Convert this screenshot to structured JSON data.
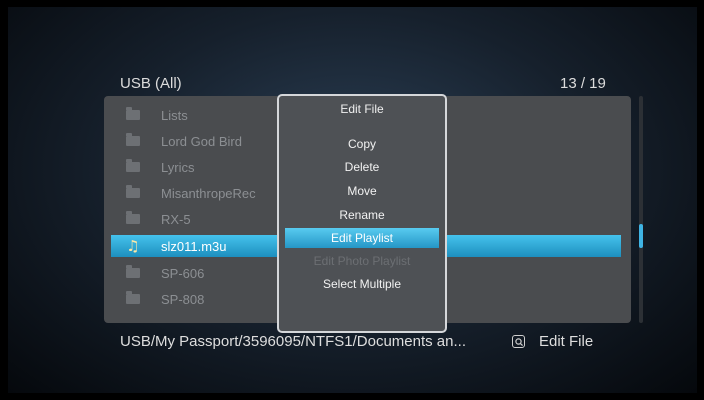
{
  "header": {
    "title": "USB (All)",
    "count": "13 / 19"
  },
  "file_list": {
    "items": [
      {
        "label": "Lists",
        "icon": "folder-icon"
      },
      {
        "label": "Lord God Bird",
        "icon": "folder-icon"
      },
      {
        "label": "Lyrics",
        "icon": "folder-icon"
      },
      {
        "label": "MisanthropeRec",
        "icon": "folder-icon"
      },
      {
        "label": "RX-5",
        "icon": "folder-icon"
      },
      {
        "label": "slz011.m3u",
        "icon": "music-note-icon",
        "selected": true
      },
      {
        "label": "SP-606",
        "icon": "folder-icon"
      },
      {
        "label": "SP-808",
        "icon": "folder-icon"
      }
    ]
  },
  "context_menu": {
    "title": "Edit File",
    "items": [
      {
        "label": "Copy"
      },
      {
        "label": "Delete"
      },
      {
        "label": "Move"
      },
      {
        "label": "Rename"
      },
      {
        "label": "Edit Playlist",
        "highlighted": true
      },
      {
        "label": "Edit Photo Playlist",
        "disabled": true
      },
      {
        "label": "Select Multiple"
      }
    ]
  },
  "footer": {
    "path": "USB/My Passport/3596095/NTFS1/Documents an...",
    "hint_label": "Edit File",
    "hint_icon": "search-key-icon"
  },
  "colors": {
    "accent": "#3fb4e4",
    "panel": "#4a4c4f"
  }
}
